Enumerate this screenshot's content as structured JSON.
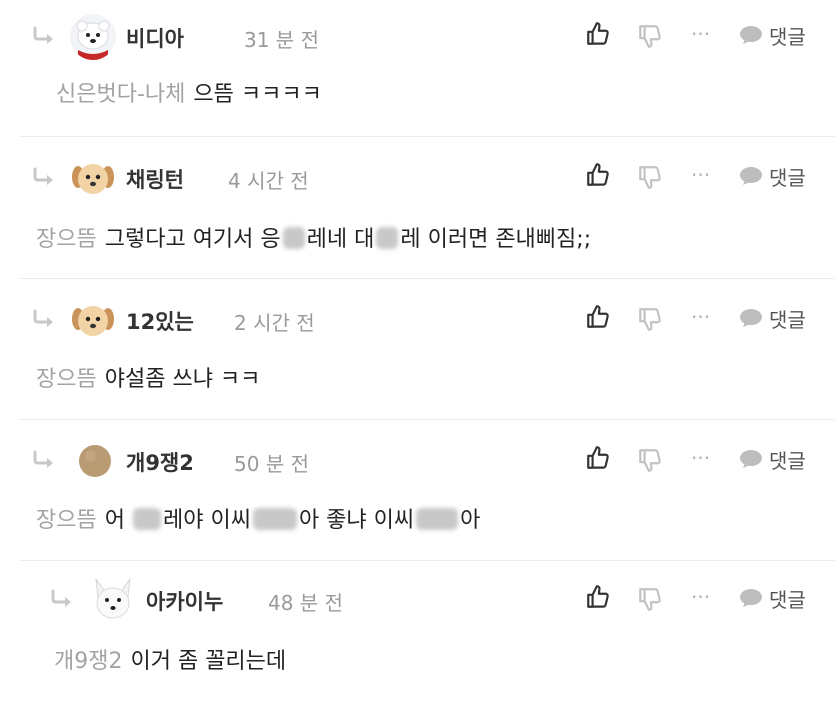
{
  "actions": {
    "more": "···",
    "reply_label": "댓글"
  },
  "comments": [
    {
      "author": "비디아",
      "time": "31 분 전",
      "mention": "신은벗다-나체",
      "text": "으뜸 ㅋㅋㅋㅋ"
    },
    {
      "author": "채링턴",
      "time": "4 시간 전",
      "mention": "장으뜸",
      "text_parts": [
        "그렇다고 여기서 응",
        "레네 대",
        "레 이러면 존내삐짐;;"
      ]
    },
    {
      "author": "12있는",
      "time": "2 시간 전",
      "mention": "장으뜸",
      "text": "야설좀 쓰냐 ㅋㅋ"
    },
    {
      "author": "개9쟁2",
      "time": "50 분 전",
      "mention": "장으뜸",
      "text_parts": [
        "어",
        "레야 이씨",
        "아 좋냐 이씨",
        "아"
      ]
    },
    {
      "author": "아카이누",
      "time": "48 분 전",
      "mention": "개9쟁2",
      "text": "이거 좀 꼴리는데"
    }
  ]
}
